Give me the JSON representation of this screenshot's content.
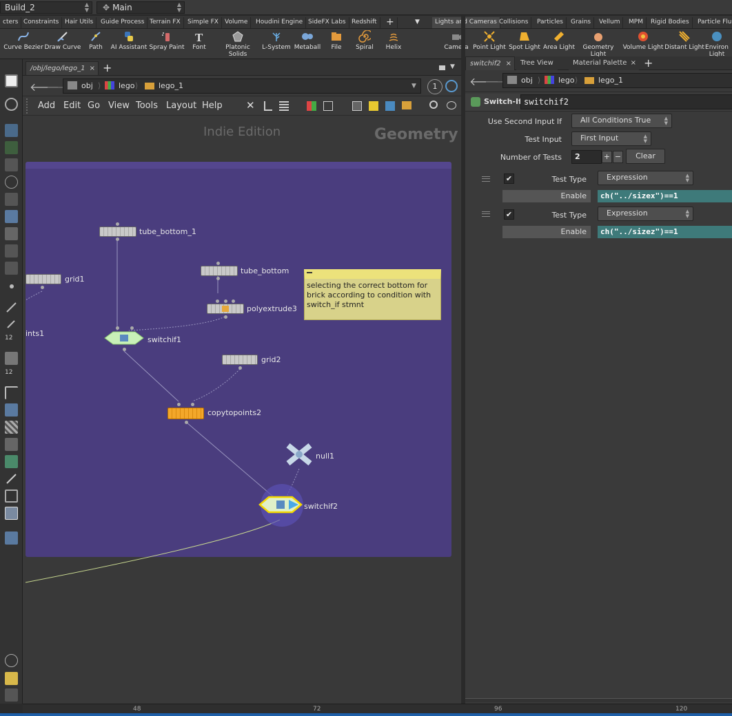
{
  "topbar": {
    "desktop": "Build_2",
    "context": "Main"
  },
  "shelf_tabs_left": [
    "cters",
    "Constraints",
    "Hair Utils",
    "Guide Process",
    "Terrain FX",
    "Simple FX",
    "Volume",
    "Houdini Engine",
    "SideFX Labs",
    "Redshift"
  ],
  "shelf_tabs_right": [
    "Lights and Cameras",
    "Collisions",
    "Particles",
    "Grains",
    "Vellum",
    "MPM",
    "Rigid Bodies",
    "Particle Fluid"
  ],
  "tools_left": [
    "Curve Bezier",
    "Draw Curve",
    "Path",
    "AI Assistant",
    "Spray Paint",
    "Font",
    "Platonic Solids",
    "L-System",
    "Metaball",
    "File",
    "Spiral",
    "Helix"
  ],
  "tools_right": [
    "Camera",
    "Point Light",
    "Spot Light",
    "Area Light",
    "Geometry Light",
    "Volume Light",
    "Distant Light",
    "Environ Light"
  ],
  "network": {
    "tab": "/obj/lego/lego_1",
    "path": [
      "obj",
      "lego",
      "lego_1"
    ],
    "menu": [
      "Add",
      "Edit",
      "Go",
      "View",
      "Tools",
      "Layout",
      "Help"
    ],
    "edition": "Indie Edition",
    "context_label": "Geometry",
    "nodes": {
      "tube_bottom_1": "tube_bottom_1",
      "grid1": "grid1",
      "tube_bottom": "tube_bottom",
      "polyextrude3": "polyextrude3",
      "ints1": "ints1",
      "switchif1": "switchif1",
      "grid2": "grid2",
      "copytopoints2": "copytopoints2",
      "null1": "null1",
      "switchif2": "switchif2"
    },
    "sticky_note": "selecting the correct bottom for brick according to condition with switch_if stmnt",
    "ruler": [
      "48",
      "72",
      "96",
      "120"
    ]
  },
  "params": {
    "tabs": [
      "switchif2",
      "Tree View",
      "Material Palette"
    ],
    "path": [
      "obj",
      "lego",
      "lego_1"
    ],
    "node_type": "Switch-If",
    "node_name": "switchif2",
    "use_second_input_if_label": "Use Second Input If",
    "use_second_input_if": "All Conditions True",
    "test_input_label": "Test Input",
    "test_input": "First Input",
    "number_of_tests_label": "Number of Tests",
    "number_of_tests": "2",
    "clear_label": "Clear",
    "tests": [
      {
        "check": "✔",
        "type_label": "Test Type",
        "type": "Expression",
        "enable_label": "Enable",
        "expr": "ch(\"../sizex\")==1"
      },
      {
        "check": "✔",
        "type_label": "Test Type",
        "type": "Expression",
        "enable_label": "Enable",
        "expr": "ch(\"../sizez\")==1"
      }
    ]
  },
  "colors": {
    "network_box": "#4a3d7e",
    "selected_node": "#f4d800",
    "expression_field": "#3e7a7a",
    "sticky": "#d8d28a"
  }
}
